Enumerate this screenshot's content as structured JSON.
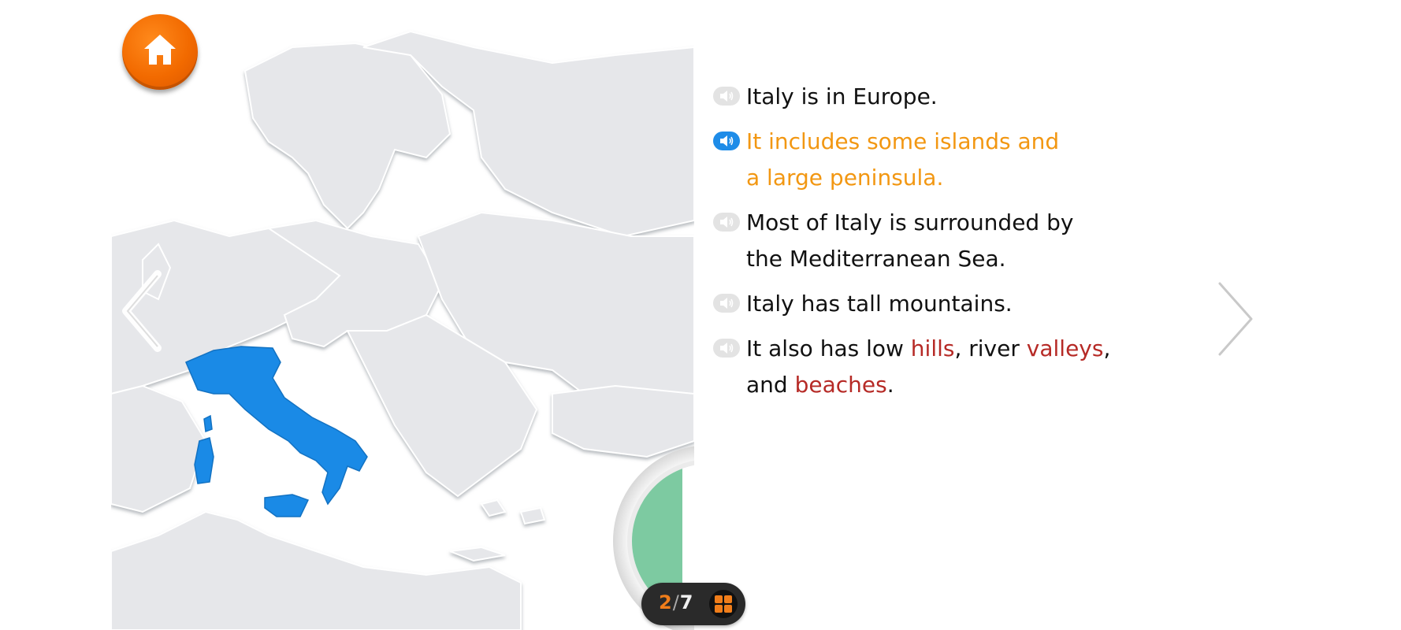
{
  "colors": {
    "italy": "#1a8ae6",
    "home_button": "#f26a00",
    "active_text": "#f29712",
    "keyword": "#b62a26",
    "speaker_active": "#1e8ce8"
  },
  "map": {
    "highlighted_country_icon": "italy-map-icon",
    "flag_icon": "italy-flag-icon"
  },
  "home_button": {
    "icon": "home-icon"
  },
  "nav": {
    "prev_icon": "chevron-left-icon",
    "next_icon": "chevron-right-icon"
  },
  "pager": {
    "current": "2",
    "separator": "/",
    "total": "7",
    "grid_icon": "grid-icon"
  },
  "sentences": [
    {
      "text": "Italy is in Europe.",
      "active": false
    },
    {
      "line1": "It includes some islands and",
      "line2": "a large peninsula.",
      "active": true
    },
    {
      "line1": "Most of Italy is surrounded by",
      "line2": "the Mediterranean Sea.",
      "active": false
    },
    {
      "text": "Italy has tall mountains.",
      "active": false
    },
    {
      "active": false,
      "part1": "It also has low ",
      "kw1": "hills",
      "part2": ", river ",
      "kw2": "valleys",
      "part3": ",",
      "part4": "and ",
      "kw3": "beaches",
      "part5": "."
    }
  ]
}
